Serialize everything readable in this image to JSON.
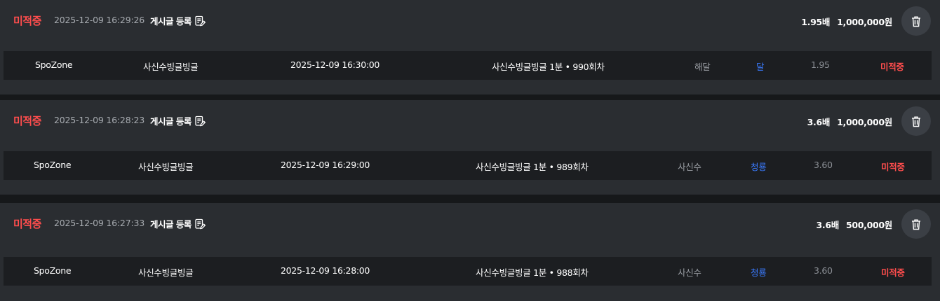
{
  "icons": {
    "post": "edit-document-icon",
    "delete": "trash-icon"
  },
  "colors": {
    "pending": "#ff4d4d",
    "result": "#3a7bff",
    "panel": "#2a2d31",
    "row": "#1c1e21"
  },
  "bets": [
    {
      "status": "미적중",
      "time": "2025-12-09 16:29:26",
      "post_label": "게시글 등록",
      "odds": "1.95배",
      "amount": "1,000,000원",
      "detail": {
        "site": "SpoZone",
        "game": "사신수빙글빙글",
        "date": "2025-12-09 16:30:00",
        "round": "사신수빙글빙글 1분 • 990회차",
        "selection": "해달",
        "result": "달",
        "odd": "1.95",
        "status": "미적중"
      }
    },
    {
      "status": "미적중",
      "time": "2025-12-09 16:28:23",
      "post_label": "게시글 등록",
      "odds": "3.6배",
      "amount": "1,000,000원",
      "detail": {
        "site": "SpoZone",
        "game": "사신수빙글빙글",
        "date": "2025-12-09 16:29:00",
        "round": "사신수빙글빙글 1분 • 989회차",
        "selection": "사신수",
        "result": "청룡",
        "odd": "3.60",
        "status": "미적중"
      }
    },
    {
      "status": "미적중",
      "time": "2025-12-09 16:27:33",
      "post_label": "게시글 등록",
      "odds": "3.6배",
      "amount": "500,000원",
      "detail": {
        "site": "SpoZone",
        "game": "사신수빙글빙글",
        "date": "2025-12-09 16:28:00",
        "round": "사신수빙글빙글 1분 • 988회차",
        "selection": "사신수",
        "result": "청룡",
        "odd": "3.60",
        "status": "미적중"
      }
    }
  ]
}
